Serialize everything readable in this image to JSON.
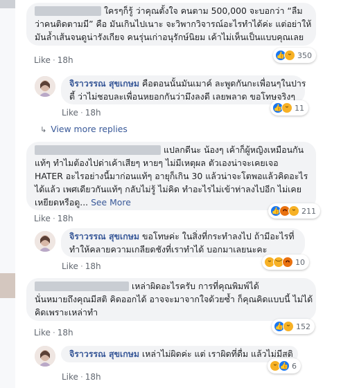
{
  "thread": [
    {
      "author": "",
      "lines": [
        "ใครๆก็รู้ ว่าคุณตั้งใจ คนตาม 500,000 จะบอกว่า “ลืม",
        "ว่าคนติดตามมี” คือ มันเกินไปเนาะ จะวิพากวิจารณ์อะไรทำได้ค่ะ แต่อย่าให้",
        "มันล้ำเส้นจนดูน่ารังเกียจ คนรุ่นเก่าอนุรักษ์นิยม เค้าไม่เห็นเป็นแบบคุณเลย"
      ],
      "like": "Like",
      "time": "18h",
      "reactions": {
        "icons": [
          "like-icon",
          "haha-icon"
        ],
        "count": "350"
      }
    },
    {
      "author": "จิราวรรณ สุขเกษม",
      "lines": [
        "คือตอนนั้นมันเมาค์ ละพูดกันกะเพื่อนๆในปาร",
        "ตี้ ว่าไม่ชอบละเพื่อนหยอกกันว่ามึงลงดี เลยพลาด ขอโทษจริงๆ"
      ],
      "like": "Like",
      "time": "18h",
      "reactions": {
        "icons": [
          "like-icon",
          "haha-icon"
        ],
        "count": "11"
      }
    },
    {
      "view_more": "View more replies"
    },
    {
      "author": "",
      "lines": [
        "แปลกดีนะ น้องๆ เค้าก็ผู้หญิงเหมือนกัน",
        "แท้ๆ ทำไมต้องไปด่าเค้าเสียๆ หายๆ ไม่มีเหตุผล ตัวเองน่าจะเคยเจอ",
        "HATER อะไรอย่างนี้มาก่อนแท้ๆ อายุก็เกิน 30 แล้วน่าจะโตพอแล้วคิดอะไร",
        "ได้แล้ว เพศเดียวกันแท้ๆ กลับไม่รู้ ไม่คิด ทำอะไรไม่เข้าท่าลงไปอีก ไม่เคย",
        "เหยียดหรือดู..."
      ],
      "see_more": "See More",
      "like": "Like",
      "time": "18h",
      "reactions": {
        "icons": [
          "like-icon",
          "angry-icon",
          "haha-icon"
        ],
        "count": "211"
      }
    },
    {
      "author": "จิราวรรณ สุขเกษม",
      "lines": [
        "ขอโทษค่ะ ในสิ่งที่กระทำลงไป ถ้ามีอะไรที่",
        "ทำให้คลายความเกลียดชังที่เราทำได้ บอกมาเลยนะคะ"
      ],
      "like": "Like",
      "time": "18h",
      "reactions": {
        "icons": [
          "haha-icon",
          "sad-icon",
          "angry-icon"
        ],
        "count": "10"
      }
    },
    {
      "author": "",
      "lines": [
        "เหล่าผิดอะไรครับ การที่คุณพิมพ์ได้",
        "นั่นหมายถึงคุณมีสติ คิดออกได้ อาจจะมาจากใจด้วยซ้ำ ก็คุณคิดแบบนี้ ไม่ได้",
        "คิดเพราะเหล่าทำ"
      ],
      "like": "Like",
      "time": "18h",
      "reactions": {
        "icons": [
          "like-icon",
          "haha-icon"
        ],
        "count": "152"
      }
    },
    {
      "author": "จิราวรรณ สุขเกษม",
      "lines": [
        "เหล่าไม่ผิดค่ะ แต่ เราผิดที่ดื่ม แล้วไม่มีสติ"
      ],
      "like": "Like",
      "time": "18h",
      "reactions": {
        "icons": [
          "haha-icon",
          "like-icon"
        ],
        "count": "6"
      }
    }
  ],
  "colors": {
    "name": "#385898",
    "bubble": "#f2f3f5",
    "meta": "#616770",
    "like_reaction": "#1877f2",
    "haha_reaction": "#f7b125",
    "angry_reaction": "#e9710f"
  }
}
